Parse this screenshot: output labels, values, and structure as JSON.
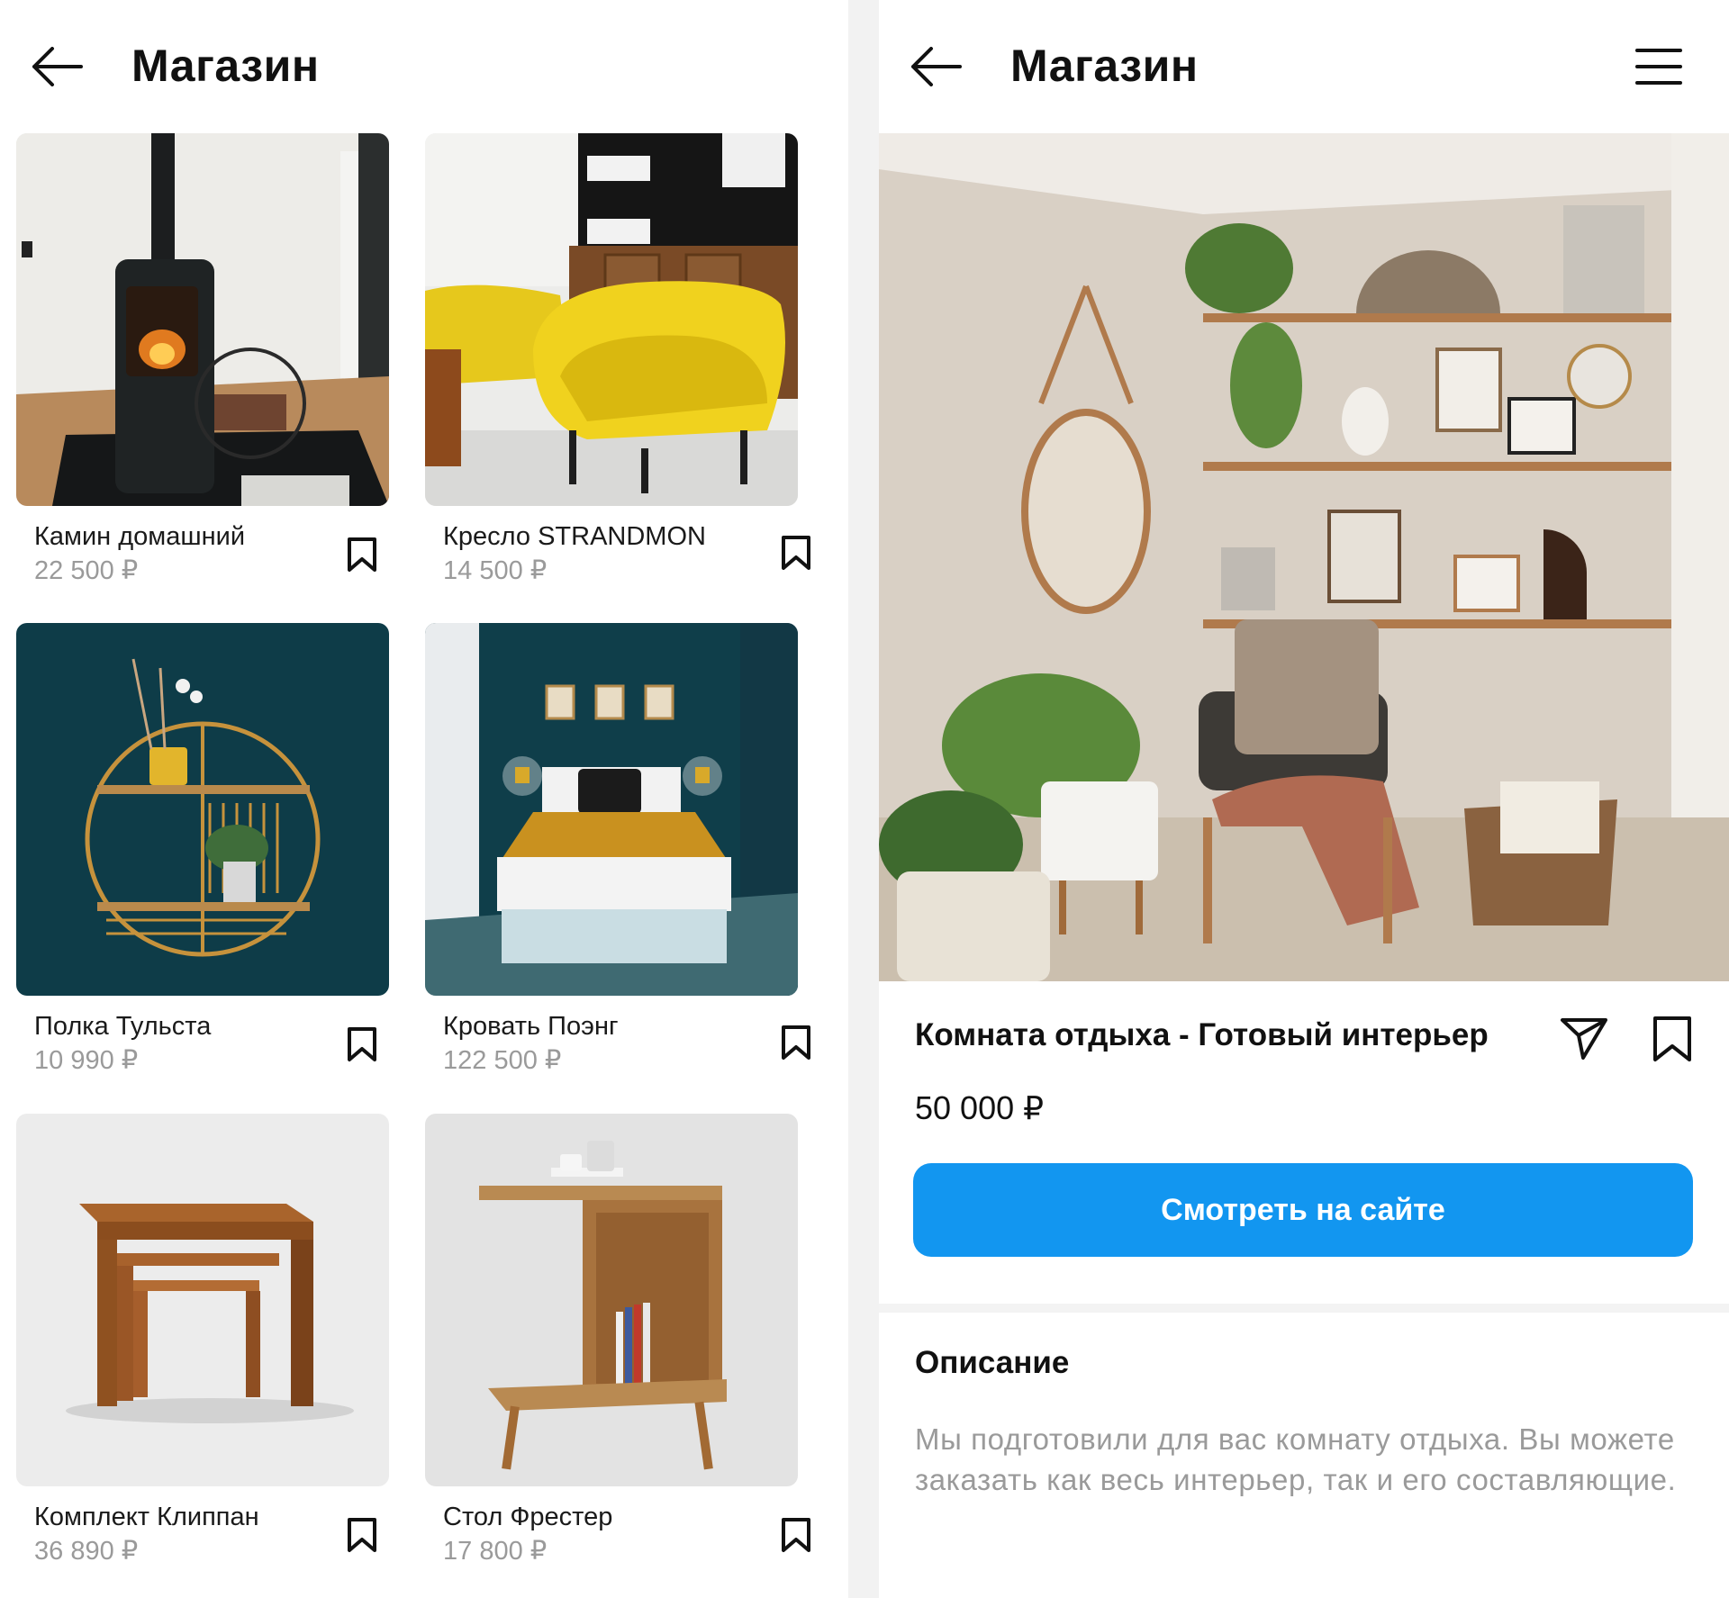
{
  "catalog": {
    "header": {
      "title": "Магазин"
    },
    "products": [
      {
        "name": "Камин домашний",
        "price": "22 500 ₽"
      },
      {
        "name": "Кресло STRANDMON",
        "price": "14 500 ₽"
      },
      {
        "name": "Полка Тульста",
        "price": "10 990 ₽"
      },
      {
        "name": "Кровать Поэнг",
        "price": "122 500 ₽"
      },
      {
        "name": "Комплект Клиппан",
        "price": "36 890 ₽"
      },
      {
        "name": "Стол Фрестер",
        "price": "17 800 ₽"
      }
    ]
  },
  "detail": {
    "header": {
      "title": "Магазин"
    },
    "product_title": "Комната отдыха - Готовый интерьер",
    "price": "50 000 ₽",
    "cta_label": "Смотреть на сайте",
    "description_heading": "Описание",
    "description": "Мы подготовили для вас комнату отдыха. Вы можете заказать как весь интерьер, так и его составляющие."
  },
  "icons": [
    "back-arrow-icon",
    "menu-icon",
    "bookmark-icon",
    "send-icon"
  ],
  "colors": {
    "accent": "#1296f0",
    "muted_text": "#9a9a9a",
    "divider": "#f2f2f2"
  }
}
